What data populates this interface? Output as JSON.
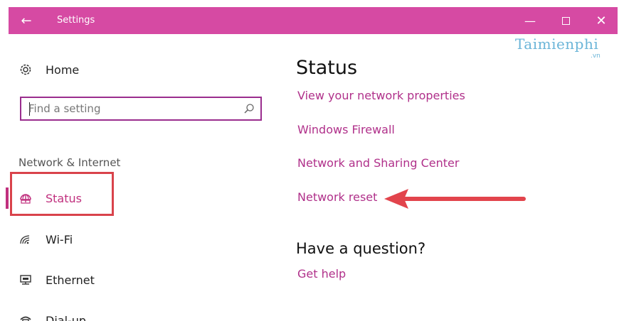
{
  "window": {
    "title": "Settings",
    "accent_color": "#d64aa3",
    "controls": {
      "minimize_icon": "minimize-icon",
      "maximize_icon": "maximize-icon",
      "close_icon": "close-icon"
    }
  },
  "watermark": {
    "main": "Taimienphi",
    "sub": ".vn"
  },
  "sidebar": {
    "home_label": "Home",
    "search": {
      "placeholder": "Find a setting"
    },
    "section_label": "Network & Internet",
    "items": [
      {
        "label": "Status",
        "icon": "status-globe-icon",
        "selected": true
      },
      {
        "label": "Wi-Fi",
        "icon": "wifi-icon",
        "selected": false
      },
      {
        "label": "Ethernet",
        "icon": "ethernet-icon",
        "selected": false
      },
      {
        "label": "Dial-up",
        "icon": "dialup-icon",
        "selected": false
      }
    ]
  },
  "main": {
    "title": "Status",
    "links": [
      "View your network properties",
      "Windows Firewall",
      "Network and Sharing Center",
      "Network reset"
    ],
    "question_heading": "Have a question?",
    "help_link": "Get help",
    "link_color": "#b0308a"
  },
  "annotations": {
    "highlight_color": "#d9434b"
  }
}
